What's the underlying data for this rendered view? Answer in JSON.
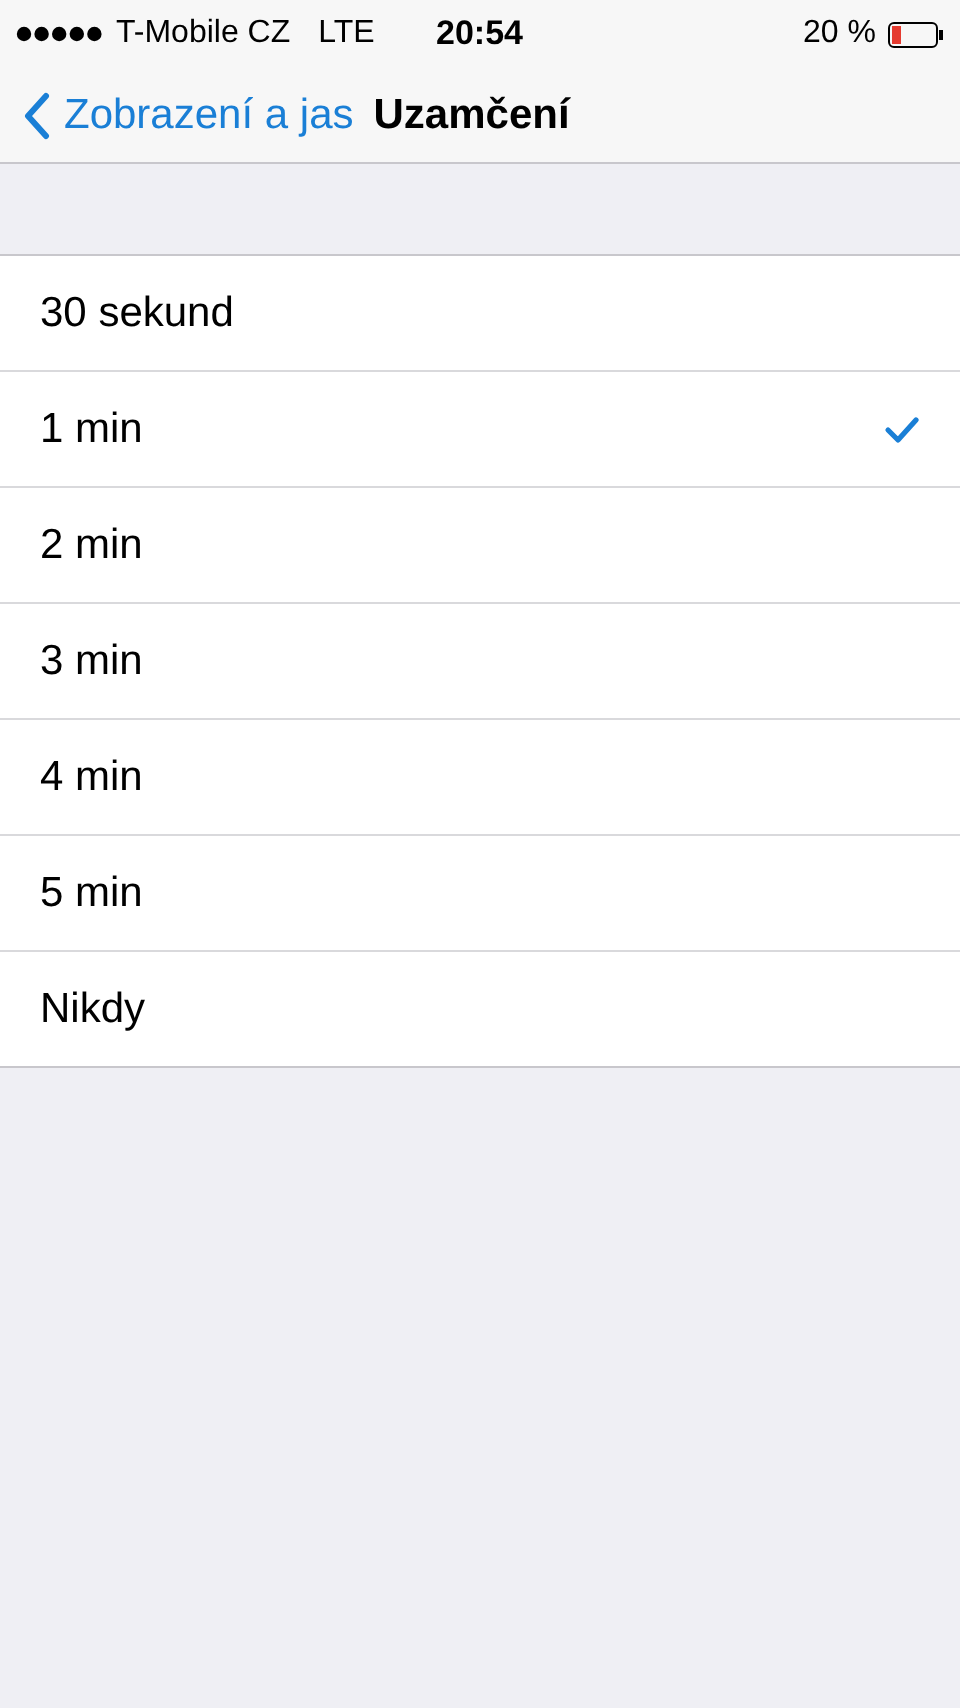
{
  "status_bar": {
    "carrier": "T-Mobile CZ",
    "network": "LTE",
    "time": "20:54",
    "battery": "20 %"
  },
  "nav": {
    "back": "Zobrazení a jas",
    "title": "Uzamčení"
  },
  "options": [
    {
      "label": "30 sekund",
      "selected": false
    },
    {
      "label": "1 min",
      "selected": true
    },
    {
      "label": "2 min",
      "selected": false
    },
    {
      "label": "3 min",
      "selected": false
    },
    {
      "label": "4 min",
      "selected": false
    },
    {
      "label": "5 min",
      "selected": false
    },
    {
      "label": "Nikdy",
      "selected": false
    }
  ]
}
